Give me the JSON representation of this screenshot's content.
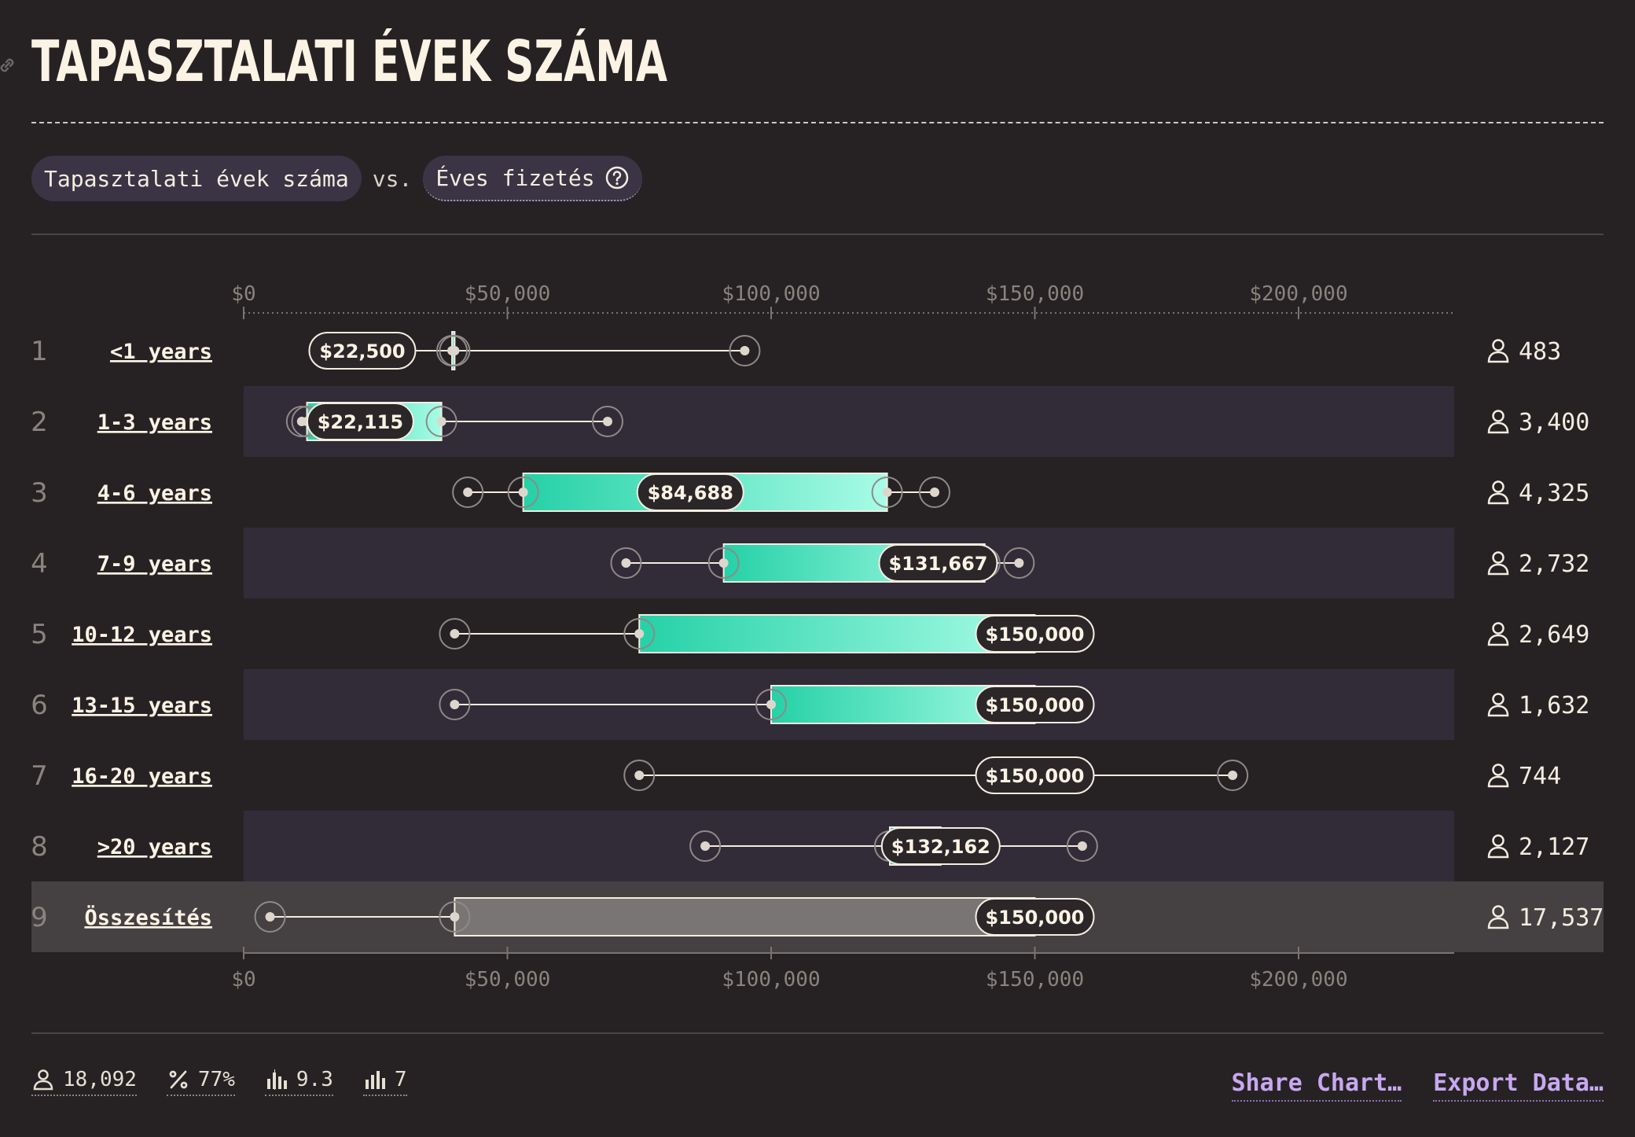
{
  "title": "TAPASZTALATI ÉVEK SZÁMA",
  "selectors": {
    "x_variable": "Tapasztalati évek száma",
    "vs": "vs.",
    "y_variable": "Éves fizetés"
  },
  "colors": {
    "background": "#262224",
    "bar_start": "#25d1a7",
    "bar_end": "#a8fce6",
    "total_bar": "#777272",
    "alt_row": "#322c38",
    "accent_link": "#c8a8f0"
  },
  "chart_data": {
    "type": "box",
    "xlim": [
      0,
      225000
    ],
    "ticks": [
      0,
      50000,
      100000,
      150000,
      200000
    ],
    "tick_labels": [
      "$0",
      "$50,000",
      "$100,000",
      "$150,000",
      "$200,000"
    ],
    "rows": [
      {
        "index": "1",
        "label": "<1 years",
        "min": 23500,
        "q1": 39500,
        "q3": 40000,
        "max": 95000,
        "median": 22500,
        "median_label": "$22,500",
        "count": "483"
      },
      {
        "index": "2",
        "label": "1-3 years",
        "min": 11000,
        "q1": 12000,
        "q3": 37500,
        "max": 69000,
        "median": 22115,
        "median_label": "$22,115",
        "count": "3,400"
      },
      {
        "index": "3",
        "label": "4-6 years",
        "min": 42500,
        "q1": 53000,
        "q3": 122000,
        "max": 131000,
        "median": 84688,
        "median_label": "$84,688",
        "count": "4,325"
      },
      {
        "index": "4",
        "label": "7-9 years",
        "min": 72500,
        "q1": 91000,
        "q3": 140500,
        "max": 147000,
        "median": 131667,
        "median_label": "$131,667",
        "count": "2,732"
      },
      {
        "index": "5",
        "label": "10-12 years",
        "min": 40000,
        "q1": 75000,
        "q3": 150000,
        "max": 150000,
        "median": 150000,
        "median_label": "$150,000",
        "count": "2,649"
      },
      {
        "index": "6",
        "label": "13-15 years",
        "min": 40000,
        "q1": 100000,
        "q3": 150000,
        "max": 150000,
        "median": 150000,
        "median_label": "$150,000",
        "count": "1,632"
      },
      {
        "index": "7",
        "label": "16-20 years",
        "min": 75000,
        "q1": 150000,
        "q3": 150000,
        "max": 187500,
        "median": 150000,
        "median_label": "$150,000",
        "count": "744"
      },
      {
        "index": "8",
        "label": ">20 years",
        "min": 87500,
        "q1": 122500,
        "q3": 132162,
        "max": 159000,
        "median": 132162,
        "median_label": "$132,162",
        "count": "2,127"
      },
      {
        "index": "9",
        "label": "Összesítés",
        "min": 5000,
        "q1": 40000,
        "q3": 150000,
        "max": 150000,
        "median": 150000,
        "median_label": "$150,000",
        "count": "17,537",
        "total": true
      }
    ]
  },
  "footer": {
    "respondents": "18,092",
    "percent": "77%",
    "mean": "9.3",
    "bins": "7",
    "share": "Share Chart…",
    "export": "Export Data…"
  }
}
